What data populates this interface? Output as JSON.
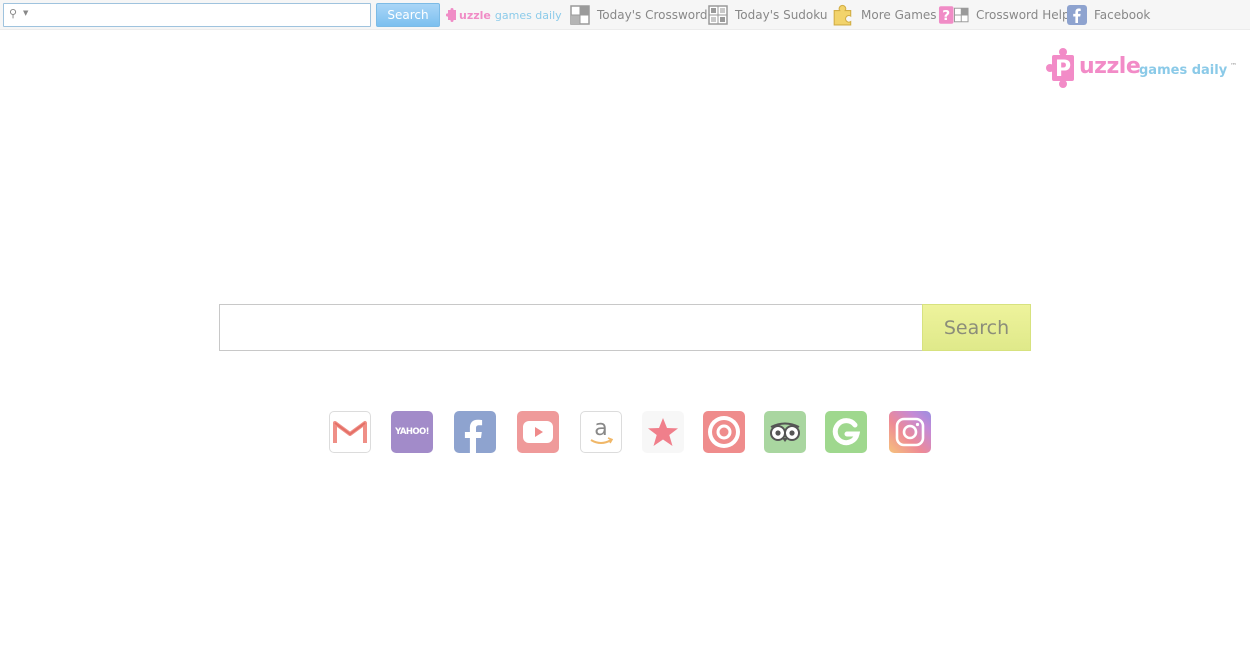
{
  "toolbar": {
    "search_value": "",
    "search_button": "Search",
    "logo": {
      "word": "uzzle",
      "letter": "P",
      "tagline": "games daily"
    },
    "items": [
      {
        "label": "Today's Crossword",
        "icon": "crossword-icon"
      },
      {
        "label": "Today's Sudoku",
        "icon": "sudoku-icon"
      },
      {
        "label": "More Games",
        "icon": "puzzle-piece-icon"
      },
      {
        "label": "Crossword Help",
        "icon": "crossword-help-icon"
      },
      {
        "label": "Facebook",
        "icon": "facebook-icon"
      }
    ]
  },
  "brand": {
    "wordmark": "uzzle",
    "letter": "P",
    "tagline": "games daily",
    "trademark": "™",
    "colors": {
      "pink": "#f28bc7",
      "blue": "#8bcae8"
    }
  },
  "search": {
    "value": "",
    "button_label": "Search",
    "button_color": "#e5ec90"
  },
  "shortcuts": [
    {
      "name": "gmail",
      "icon": "gmail-icon",
      "color": "#ffffff"
    },
    {
      "name": "yahoo",
      "icon": "yahoo-icon",
      "label": "YAHOO!",
      "color": "#a28bc9"
    },
    {
      "name": "facebook",
      "icon": "facebook-icon",
      "color": "#8ea3cf"
    },
    {
      "name": "youtube",
      "icon": "youtube-icon",
      "color": "#ef9a9a"
    },
    {
      "name": "amazon",
      "icon": "amazon-icon",
      "color": "#ffffff"
    },
    {
      "name": "favorites",
      "icon": "star-icon",
      "color": "#f7f7f7"
    },
    {
      "name": "target",
      "icon": "target-icon",
      "color": "#ef8c8c"
    },
    {
      "name": "tripadvisor",
      "icon": "tripadvisor-icon",
      "color": "#a9d6a0"
    },
    {
      "name": "grammarly",
      "icon": "grammarly-icon",
      "color": "#9fd88e"
    },
    {
      "name": "instagram",
      "icon": "instagram-icon",
      "color": "#c58ad6"
    }
  ]
}
